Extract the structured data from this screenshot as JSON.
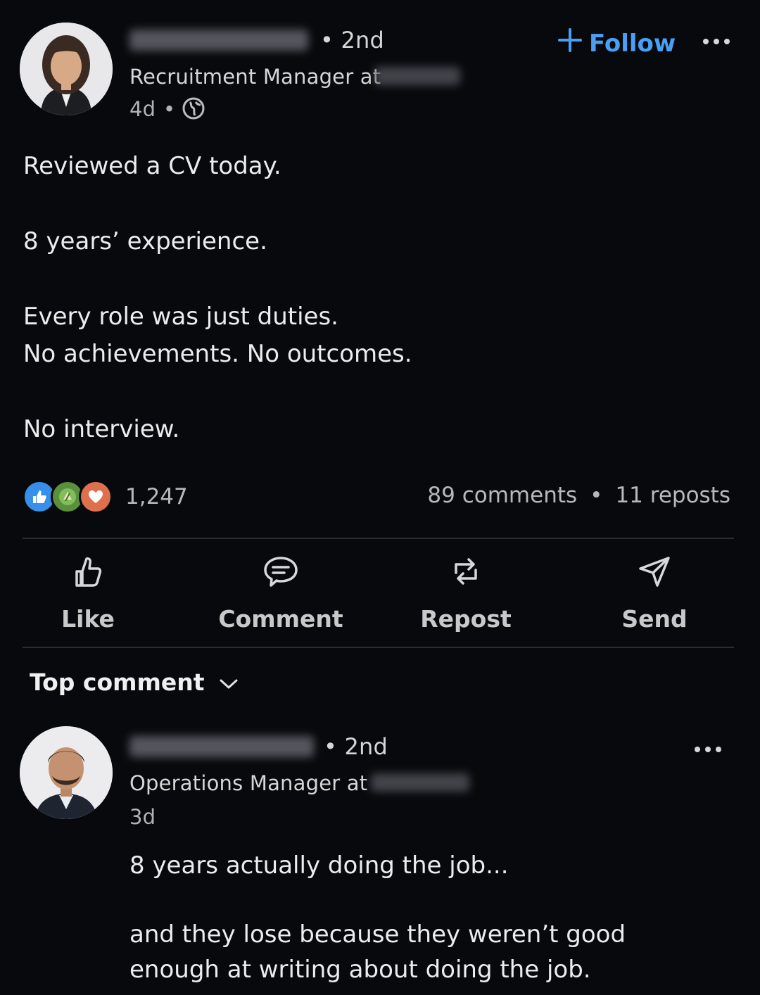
{
  "post": {
    "author": {
      "name": "",
      "degree": "• 2nd",
      "headline": "Recruitment Manager at",
      "time": "4d",
      "time_separator": "•",
      "visibility_icon": "globe-icon"
    },
    "follow_label": "Follow",
    "body": [
      "Reviewed a CV today.",
      "8 years’ experience.",
      "Every role was just duties.",
      "No achievements. No outcomes.",
      "No interview."
    ],
    "stats": {
      "reactions_count": "1,247",
      "reaction_icons": [
        "like-icon",
        "celebrate-icon",
        "love-icon"
      ],
      "comments": "89 comments",
      "separator": "•",
      "reposts": "11 reposts"
    },
    "actions": [
      {
        "label": "Like",
        "icon": "thumbs-up-icon"
      },
      {
        "label": "Comment",
        "icon": "comment-icon"
      },
      {
        "label": "Repost",
        "icon": "repost-icon"
      },
      {
        "label": "Send",
        "icon": "send-icon"
      }
    ]
  },
  "comments_section": {
    "sort_label": "Top comment",
    "comment": {
      "author_name": "",
      "degree": "• 2nd",
      "headline": "Operations Manager at",
      "time": "3d",
      "body": [
        "8 years actually doing the job...",
        "and they lose because they weren’t good",
        "enough at writing about doing the job."
      ]
    }
  },
  "colors": {
    "background": "#07090d",
    "accent": "#4a9ff5",
    "like": "#378fe9",
    "celebrate": "#44712e",
    "love": "#df704d"
  }
}
